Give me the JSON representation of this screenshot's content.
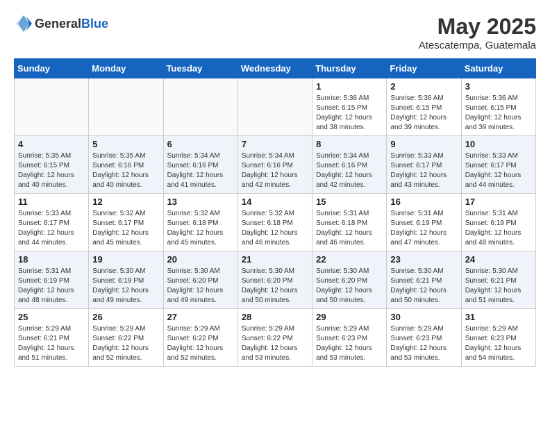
{
  "logo": {
    "general": "General",
    "blue": "Blue"
  },
  "header": {
    "title": "May 2025",
    "subtitle": "Atescatempa, Guatemala"
  },
  "weekdays": [
    "Sunday",
    "Monday",
    "Tuesday",
    "Wednesday",
    "Thursday",
    "Friday",
    "Saturday"
  ],
  "weeks": [
    [
      {
        "day": "",
        "content": ""
      },
      {
        "day": "",
        "content": ""
      },
      {
        "day": "",
        "content": ""
      },
      {
        "day": "",
        "content": ""
      },
      {
        "day": "1",
        "content": "Sunrise: 5:36 AM\nSunset: 6:15 PM\nDaylight: 12 hours\nand 38 minutes."
      },
      {
        "day": "2",
        "content": "Sunrise: 5:36 AM\nSunset: 6:15 PM\nDaylight: 12 hours\nand 39 minutes."
      },
      {
        "day": "3",
        "content": "Sunrise: 5:36 AM\nSunset: 6:15 PM\nDaylight: 12 hours\nand 39 minutes."
      }
    ],
    [
      {
        "day": "4",
        "content": "Sunrise: 5:35 AM\nSunset: 6:15 PM\nDaylight: 12 hours\nand 40 minutes."
      },
      {
        "day": "5",
        "content": "Sunrise: 5:35 AM\nSunset: 6:16 PM\nDaylight: 12 hours\nand 40 minutes."
      },
      {
        "day": "6",
        "content": "Sunrise: 5:34 AM\nSunset: 6:16 PM\nDaylight: 12 hours\nand 41 minutes."
      },
      {
        "day": "7",
        "content": "Sunrise: 5:34 AM\nSunset: 6:16 PM\nDaylight: 12 hours\nand 42 minutes."
      },
      {
        "day": "8",
        "content": "Sunrise: 5:34 AM\nSunset: 6:16 PM\nDaylight: 12 hours\nand 42 minutes."
      },
      {
        "day": "9",
        "content": "Sunrise: 5:33 AM\nSunset: 6:17 PM\nDaylight: 12 hours\nand 43 minutes."
      },
      {
        "day": "10",
        "content": "Sunrise: 5:33 AM\nSunset: 6:17 PM\nDaylight: 12 hours\nand 44 minutes."
      }
    ],
    [
      {
        "day": "11",
        "content": "Sunrise: 5:33 AM\nSunset: 6:17 PM\nDaylight: 12 hours\nand 44 minutes."
      },
      {
        "day": "12",
        "content": "Sunrise: 5:32 AM\nSunset: 6:17 PM\nDaylight: 12 hours\nand 45 minutes."
      },
      {
        "day": "13",
        "content": "Sunrise: 5:32 AM\nSunset: 6:18 PM\nDaylight: 12 hours\nand 45 minutes."
      },
      {
        "day": "14",
        "content": "Sunrise: 5:32 AM\nSunset: 6:18 PM\nDaylight: 12 hours\nand 46 minutes."
      },
      {
        "day": "15",
        "content": "Sunrise: 5:31 AM\nSunset: 6:18 PM\nDaylight: 12 hours\nand 46 minutes."
      },
      {
        "day": "16",
        "content": "Sunrise: 5:31 AM\nSunset: 6:19 PM\nDaylight: 12 hours\nand 47 minutes."
      },
      {
        "day": "17",
        "content": "Sunrise: 5:31 AM\nSunset: 6:19 PM\nDaylight: 12 hours\nand 48 minutes."
      }
    ],
    [
      {
        "day": "18",
        "content": "Sunrise: 5:31 AM\nSunset: 6:19 PM\nDaylight: 12 hours\nand 48 minutes."
      },
      {
        "day": "19",
        "content": "Sunrise: 5:30 AM\nSunset: 6:19 PM\nDaylight: 12 hours\nand 49 minutes."
      },
      {
        "day": "20",
        "content": "Sunrise: 5:30 AM\nSunset: 6:20 PM\nDaylight: 12 hours\nand 49 minutes."
      },
      {
        "day": "21",
        "content": "Sunrise: 5:30 AM\nSunset: 6:20 PM\nDaylight: 12 hours\nand 50 minutes."
      },
      {
        "day": "22",
        "content": "Sunrise: 5:30 AM\nSunset: 6:20 PM\nDaylight: 12 hours\nand 50 minutes."
      },
      {
        "day": "23",
        "content": "Sunrise: 5:30 AM\nSunset: 6:21 PM\nDaylight: 12 hours\nand 50 minutes."
      },
      {
        "day": "24",
        "content": "Sunrise: 5:30 AM\nSunset: 6:21 PM\nDaylight: 12 hours\nand 51 minutes."
      }
    ],
    [
      {
        "day": "25",
        "content": "Sunrise: 5:29 AM\nSunset: 6:21 PM\nDaylight: 12 hours\nand 51 minutes."
      },
      {
        "day": "26",
        "content": "Sunrise: 5:29 AM\nSunset: 6:22 PM\nDaylight: 12 hours\nand 52 minutes."
      },
      {
        "day": "27",
        "content": "Sunrise: 5:29 AM\nSunset: 6:22 PM\nDaylight: 12 hours\nand 52 minutes."
      },
      {
        "day": "28",
        "content": "Sunrise: 5:29 AM\nSunset: 6:22 PM\nDaylight: 12 hours\nand 53 minutes."
      },
      {
        "day": "29",
        "content": "Sunrise: 5:29 AM\nSunset: 6:23 PM\nDaylight: 12 hours\nand 53 minutes."
      },
      {
        "day": "30",
        "content": "Sunrise: 5:29 AM\nSunset: 6:23 PM\nDaylight: 12 hours\nand 53 minutes."
      },
      {
        "day": "31",
        "content": "Sunrise: 5:29 AM\nSunset: 6:23 PM\nDaylight: 12 hours\nand 54 minutes."
      }
    ]
  ]
}
